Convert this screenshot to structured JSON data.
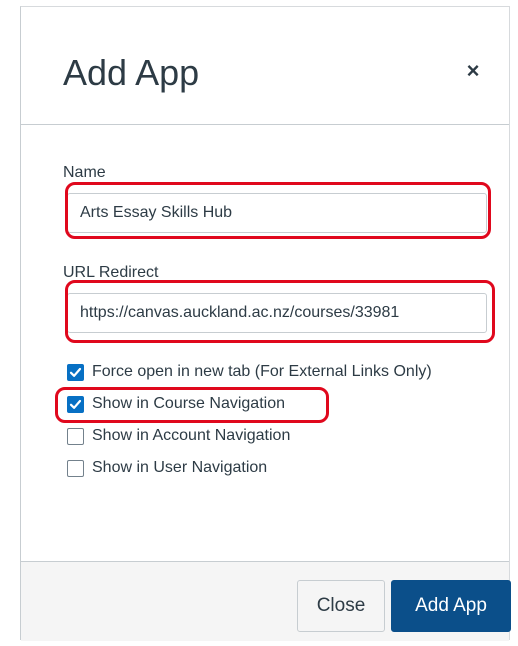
{
  "modal": {
    "title": "Add App",
    "close_glyph": "×",
    "close_icon": "close-icon"
  },
  "form": {
    "name_label": "Name",
    "name_value": "Arts Essay Skills Hub",
    "url_label": "URL Redirect",
    "url_value": "https://canvas.auckland.ac.nz/courses/33981",
    "options": [
      {
        "label": "Force open in new tab (For External Links Only)",
        "checked": true
      },
      {
        "label": "Show in Course Navigation",
        "checked": true
      },
      {
        "label": "Show in Account Navigation",
        "checked": false
      },
      {
        "label": "Show in User Navigation",
        "checked": false
      }
    ]
  },
  "footer": {
    "close_label": "Close",
    "submit_label": "Add App"
  },
  "colors": {
    "primary": "#0b4f8a",
    "checkbox_checked": "#0770c4",
    "highlight": "#e0081d",
    "text": "#2d3b45",
    "footer_bg": "#f5f5f5"
  }
}
